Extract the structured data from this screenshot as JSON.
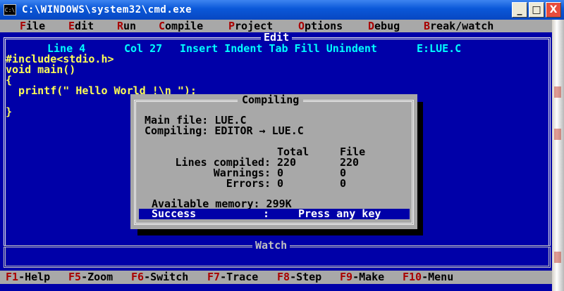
{
  "window": {
    "title": "C:\\WINDOWS\\system32\\cmd.exe",
    "icon_text": "C:\\",
    "minimize": "_",
    "maximize": "□",
    "close": "X"
  },
  "menu": [
    {
      "hotkey": "F",
      "rest": "ile"
    },
    {
      "hotkey": "E",
      "rest": "dit"
    },
    {
      "hotkey": "R",
      "rest": "un"
    },
    {
      "hotkey": "C",
      "rest": "ompile"
    },
    {
      "hotkey": "P",
      "rest": "roject"
    },
    {
      "hotkey": "O",
      "rest": "ptions"
    },
    {
      "hotkey": "D",
      "rest": "ebug"
    },
    {
      "hotkey": "B",
      "rest": "reak/watch"
    }
  ],
  "editor": {
    "title": "Edit",
    "status": {
      "line": "Line 4",
      "col": "Col 27",
      "flags": "Insert Indent Tab Fill Unindent",
      "file": "E:LUE.C"
    },
    "code": [
      "#include<stdio.h>",
      "void main()",
      "{",
      "  printf(\" Hello World !\\n \");",
      "",
      "}"
    ]
  },
  "dialog": {
    "title": "Compiling",
    "main_file": "Main file: LUE.C",
    "compiling": "Compiling: EDITOR → LUE.C",
    "headers": {
      "total": "Total",
      "file": "File"
    },
    "rows": [
      {
        "label": "Lines compiled:",
        "total": "220",
        "file": "220"
      },
      {
        "label": "Warnings:",
        "total": "0",
        "file": "0"
      },
      {
        "label": "Errors:",
        "total": "0",
        "file": "0"
      }
    ],
    "memory": "Available memory: 299K",
    "result": "Success",
    "separator": ":",
    "prompt": "Press any key"
  },
  "watch": {
    "title": "Watch"
  },
  "function_keys": [
    {
      "key": "F1",
      "label": "-Help"
    },
    {
      "key": "F5",
      "label": "-Zoom"
    },
    {
      "key": "F6",
      "label": "-Switch"
    },
    {
      "key": "F7",
      "label": "-Trace"
    },
    {
      "key": "F8",
      "label": "-Step"
    },
    {
      "key": "F9",
      "label": "-Make"
    },
    {
      "key": "F10",
      "label": "-Menu"
    }
  ]
}
